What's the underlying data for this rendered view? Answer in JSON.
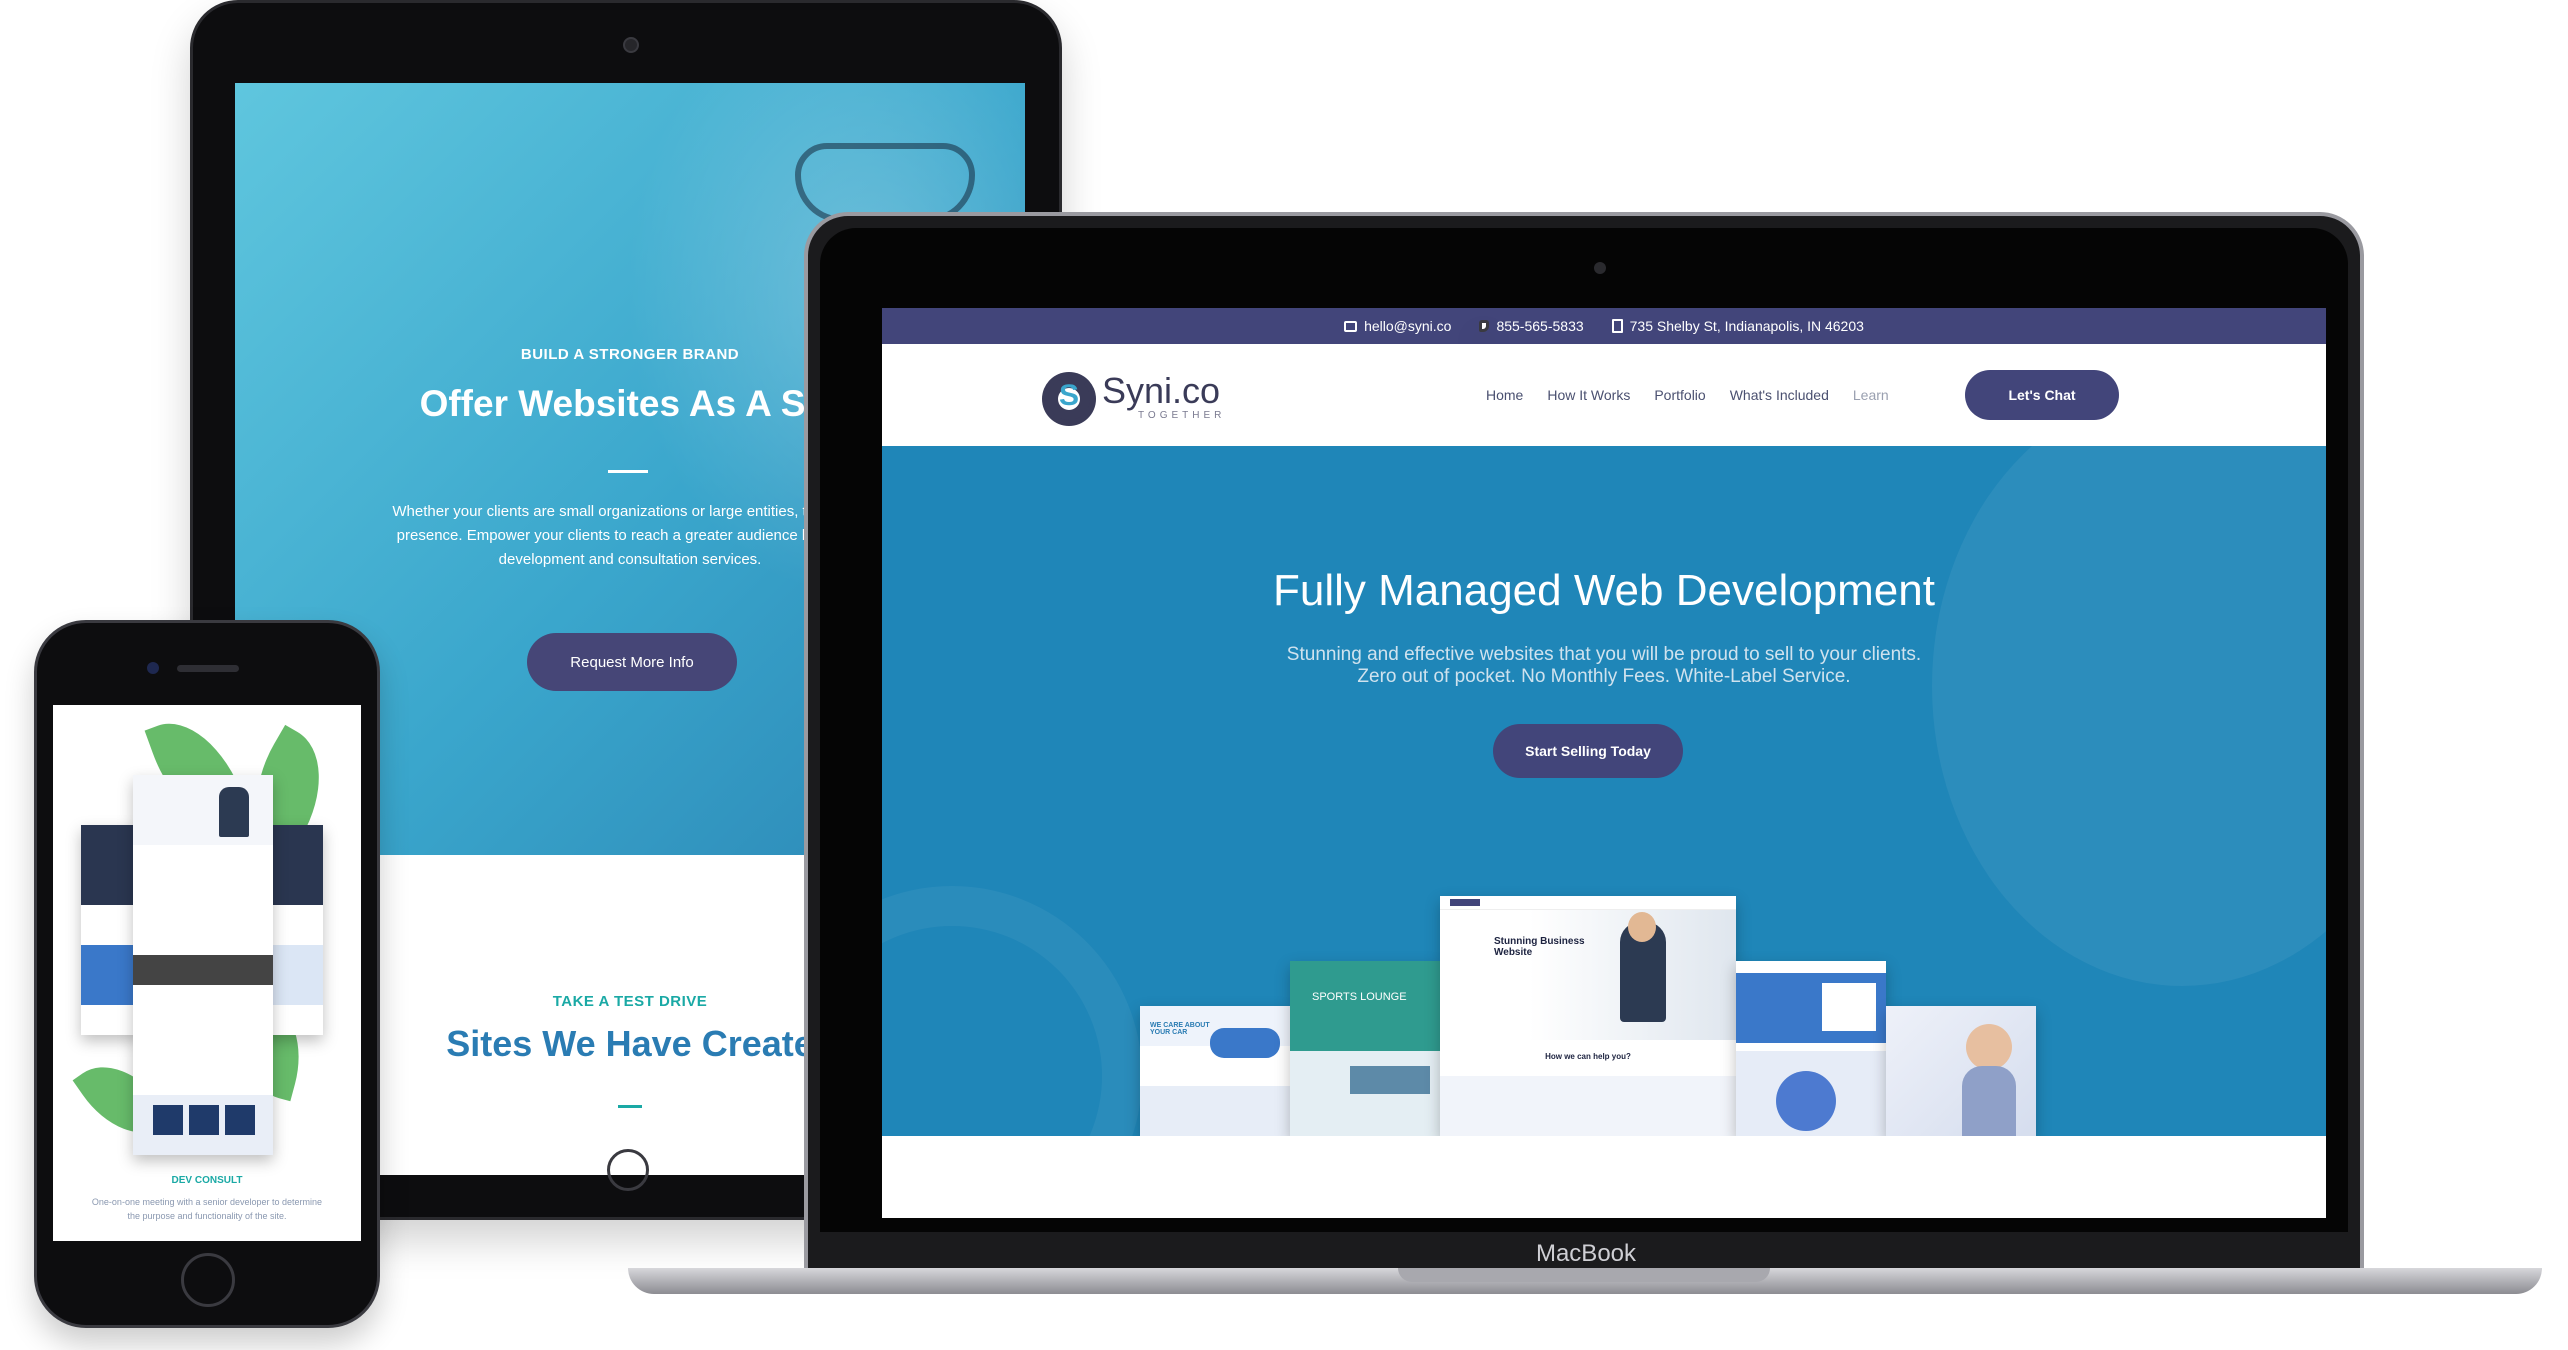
{
  "tablet": {
    "kicker": "BUILD A STRONGER BRAND",
    "title": "Offer Websites As A Ser",
    "body_lines": [
      "Whether your clients are small organizations or large entities, they dese",
      "presence. Empower your clients to reach a greater audience by offerin",
      "development and consultation services."
    ],
    "button": "Request More Info",
    "section_kicker": "TAKE A TEST DRIVE",
    "section_title": "Sites We Have Create"
  },
  "laptop": {
    "brand_label": "MacBook",
    "topbar": {
      "email": "hello@syni.co",
      "phone": "855-565-5833",
      "address": "735 Shelby St, Indianapolis, IN 46203"
    },
    "logo": {
      "name": "Syni.co",
      "tagline": "TOGETHER"
    },
    "nav": [
      "Home",
      "How It Works",
      "Portfolio",
      "What's Included",
      "Learn"
    ],
    "cta": "Let's Chat",
    "hero": {
      "title": "Fully Managed Web Development",
      "subtitle_lines": [
        "Stunning and effective websites that you will be proud to sell to your clients.",
        "Zero out of pocket. No Monthly Fees. White-Label Service."
      ],
      "button": "Start Selling Today"
    },
    "mockups": {
      "center_heading": "Stunning Business Website",
      "center_sub": "How we can help you?",
      "left_sub": "SPORTS LOUNGE",
      "far_left": "WE CARE ABOUT YOUR CAR"
    }
  },
  "phone": {
    "label": "DEV CONSULT",
    "body_lines": [
      "One-on-one meeting with a senior developer to determine",
      "the purpose and functionality of the site."
    ]
  }
}
